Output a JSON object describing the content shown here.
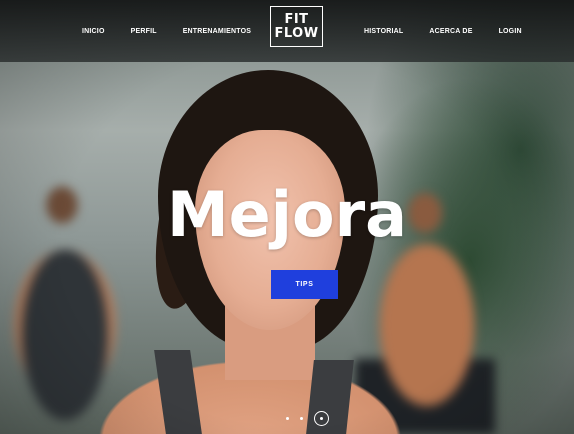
{
  "nav": {
    "left": [
      "INICIO",
      "PERFIL",
      "ENTRENAMIENTOS"
    ],
    "right": [
      "HISTORIAL",
      "ACERCA DE",
      "LOGIN"
    ]
  },
  "logo": {
    "line1": "FIT",
    "line2": "FLOW"
  },
  "hero": {
    "headline": "Mejora",
    "button_label": "TIPS",
    "button_color": "#1f3fdd"
  },
  "carousel": {
    "total_slides": 3,
    "active_slide": 3
  }
}
